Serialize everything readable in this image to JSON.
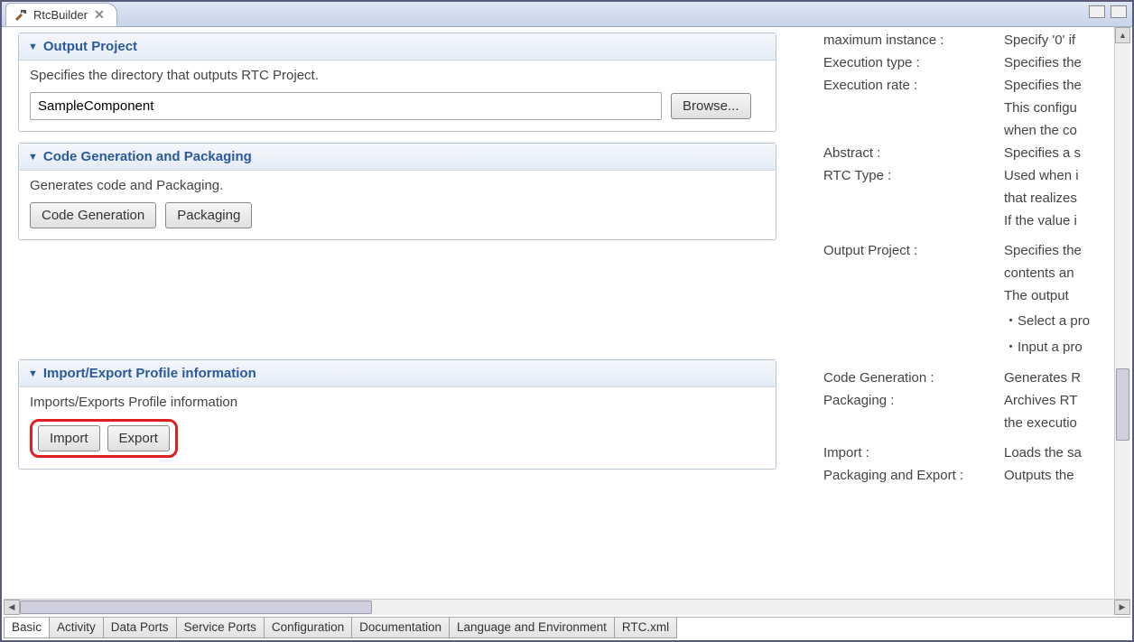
{
  "tab": {
    "title": "RtcBuilder"
  },
  "sections": {
    "output": {
      "title": "Output Project",
      "desc": "Specifies the directory that outputs RTC Project.",
      "value": "SampleComponent",
      "browse": "Browse..."
    },
    "codegen": {
      "title": "Code Generation and Packaging",
      "desc": "Generates code and Packaging.",
      "btn_code": "Code Generation",
      "btn_pack": "Packaging"
    },
    "profile": {
      "title": "Import/Export Profile information",
      "desc": "Imports/Exports Profile information",
      "btn_import": "Import",
      "btn_export": "Export"
    }
  },
  "hints": [
    {
      "label": "maximum instance :",
      "desc": "Specify '0' if"
    },
    {
      "label": "Execution type :",
      "desc": "Specifies the"
    },
    {
      "label": "Execution rate :",
      "desc": "Specifies the"
    },
    {
      "label": "",
      "desc": "This configu"
    },
    {
      "label": "",
      "desc": "when the co"
    },
    {
      "label": "Abstract :",
      "desc": "Specifies a s"
    },
    {
      "label": "RTC Type :",
      "desc": "Used when i"
    },
    {
      "label": "",
      "desc": "that realizes"
    },
    {
      "label": "",
      "desc": "If the value i"
    },
    {
      "label": "",
      "desc": ""
    },
    {
      "label": "Output Project :",
      "desc": "Specifies the"
    },
    {
      "label": "",
      "desc": "contents an"
    },
    {
      "label": "",
      "desc": "The output "
    },
    {
      "label": "",
      "desc": "・Select a pro"
    },
    {
      "label": "",
      "desc": "・Input a pro"
    },
    {
      "label": "",
      "desc": ""
    },
    {
      "label": "Code Generation :",
      "desc": "Generates R"
    },
    {
      "label": "Packaging :",
      "desc": "Archives RT"
    },
    {
      "label": "",
      "desc": "the executio"
    },
    {
      "label": "",
      "desc": ""
    },
    {
      "label": "Import :",
      "desc": "Loads the sa"
    },
    {
      "label": "Packaging and Export :",
      "desc": "Outputs the"
    }
  ],
  "bottom_tabs": [
    "Basic",
    "Activity",
    "Data Ports",
    "Service Ports",
    "Configuration",
    "Documentation",
    "Language and Environment",
    "RTC.xml"
  ]
}
